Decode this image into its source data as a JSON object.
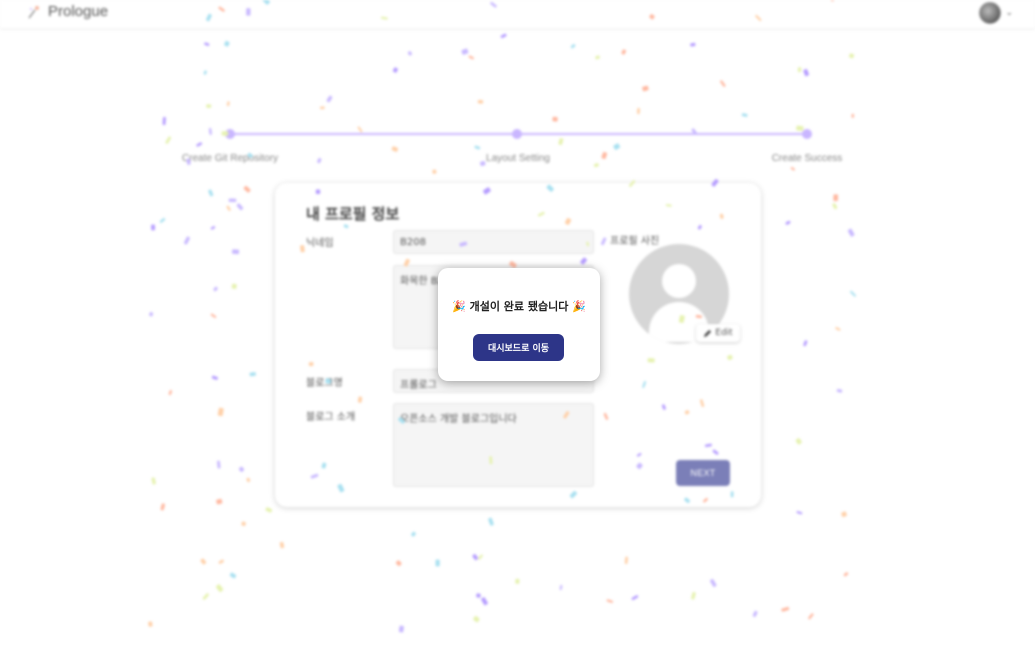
{
  "header": {
    "app_name": "Prologue",
    "logo_icon": "sparkle-icon",
    "caret": "⌄"
  },
  "stepper": {
    "steps": [
      {
        "label": "Create Git Repository"
      },
      {
        "label": "Layout Setting"
      },
      {
        "label": "Create Success"
      }
    ],
    "active_color": "#c9b6ff"
  },
  "profile_form": {
    "title": "내 프로필 정보",
    "nickname_label": "닉네임",
    "nickname_value": "B208",
    "bio_value": "화목한 B2",
    "blog_name_label": "블로그명",
    "blog_name_value": "프롤로그",
    "blog_intro_label": "블로그 소개",
    "blog_intro_value": "오픈소스 개발 블로그입니다",
    "photo_label": "프로필 사진",
    "edit_label": "Edit",
    "next_label": "NEXT"
  },
  "modal": {
    "message": "🎉 개설이 완료 됐습니다 🎉",
    "button_label": "대시보드로 이동",
    "button_color": "#2d3588"
  },
  "confetti_colors": [
    "#b59cff",
    "#ffd0a8",
    "#e6f2b0",
    "#c8b8ff",
    "#ffb8a0",
    "#a8e0f0"
  ]
}
